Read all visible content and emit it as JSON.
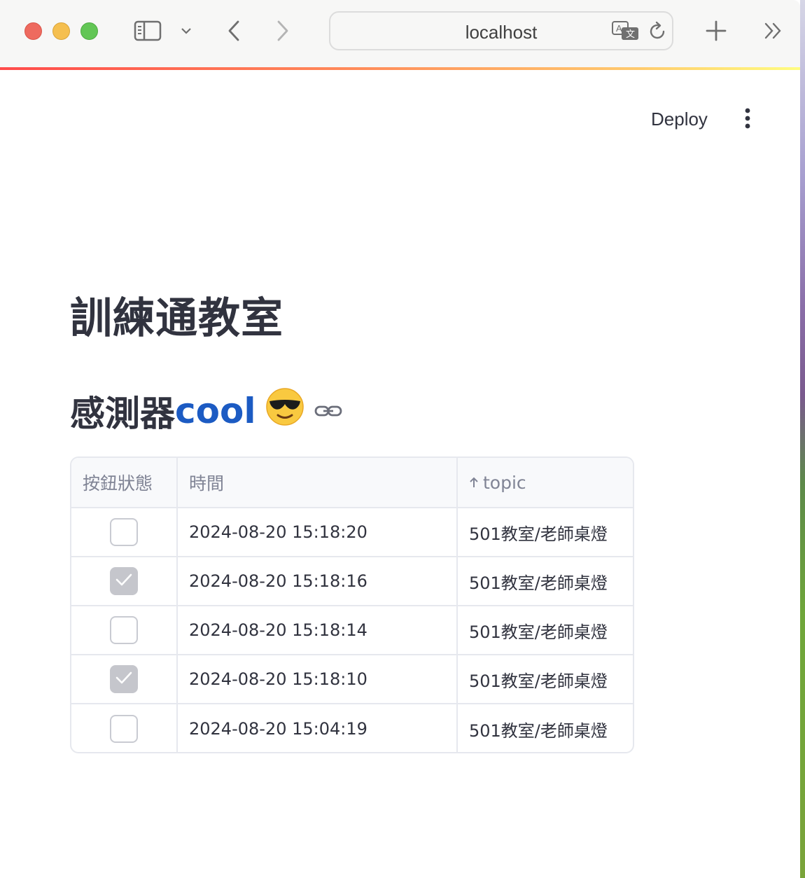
{
  "browser": {
    "url": "localhost"
  },
  "app_header": {
    "deploy_label": "Deploy"
  },
  "page": {
    "title": "訓練通教室",
    "subheader_prefix": "感測器",
    "subheader_colored": "cool",
    "subheader_emoji": "😎"
  },
  "colors": {
    "accent_blue": "#1c5bc3",
    "text": "#31333f",
    "header_text": "#808495"
  },
  "table": {
    "columns": [
      "按鈕狀態",
      "時間",
      "topic"
    ],
    "sorted_column": "topic",
    "sort_direction": "ascending",
    "rows": [
      {
        "checked": false,
        "time": "2024-08-20 15:18:20",
        "topic": "501教室/老師桌燈"
      },
      {
        "checked": true,
        "time": "2024-08-20 15:18:16",
        "topic": "501教室/老師桌燈"
      },
      {
        "checked": false,
        "time": "2024-08-20 15:18:14",
        "topic": "501教室/老師桌燈"
      },
      {
        "checked": true,
        "time": "2024-08-20 15:18:10",
        "topic": "501教室/老師桌燈"
      },
      {
        "checked": false,
        "time": "2024-08-20 15:04:19",
        "topic": "501教室/老師桌燈"
      }
    ]
  }
}
